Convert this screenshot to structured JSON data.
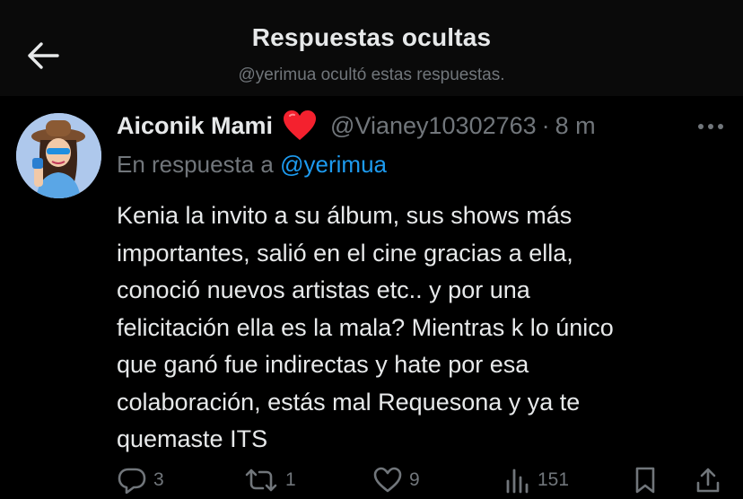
{
  "header": {
    "title": "Respuestas ocultas",
    "subtitle": "@yerimua ocultó estas respuestas."
  },
  "tweet": {
    "display_name": "Aiconik Mami",
    "handle": "@Vianey10302763",
    "separator": "·",
    "time": "8 m",
    "reply_prefix": "En respuesta a",
    "reply_mention": "@yerimua",
    "text": "Kenia la invito a su álbum, sus shows más\nimportantes, salió en el cine gracias a ella,\nconoció nuevos artistas  etc.. y por una\nfelicitación ella es la mala? Mientras k lo único\nque ganó fue indirectas y hate por esa\ncolaboración, estás mal Requesona y ya te\nquemaste ITS"
  },
  "actions": {
    "replies": "3",
    "retweets": "1",
    "likes": "9",
    "views": "151"
  },
  "icons": {
    "back": "arrow-left-icon",
    "heart_emoji": "red-heart-emoji",
    "more": "more-horizontal-icon",
    "reply": "reply-icon",
    "retweet": "retweet-icon",
    "like": "like-icon",
    "views": "views-icon",
    "bookmark": "bookmark-icon",
    "share": "share-icon"
  },
  "colors": {
    "background": "#000000",
    "header_bg": "#0a0a0a",
    "primary_text": "#e7e9ea",
    "secondary_text": "#71767b",
    "link": "#1d9bf0",
    "heart": "#f4212e"
  }
}
